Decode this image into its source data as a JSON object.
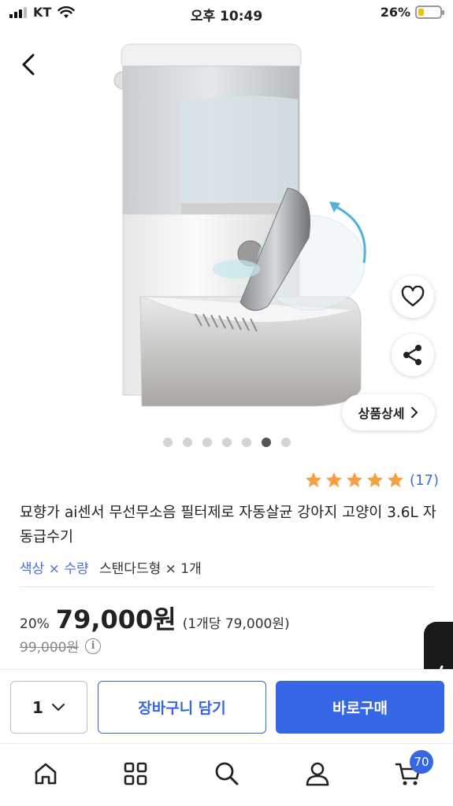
{
  "status_bar": {
    "carrier": "KT",
    "time": "오후 10:49",
    "battery_percent": "26%",
    "battery_level": 0.26
  },
  "hero": {
    "image_icon": "automatic-pet-water-dispenser-image",
    "detail_button": "상품상세",
    "slide_count": 7,
    "active_slide": 6
  },
  "product": {
    "rating": 5,
    "review_count": "(17)",
    "title": "묘향가 ai센서 무선무소음 필터제로 자동살균 강아지 고양이 3.6L 자동급수기",
    "option_label": "색상 × 수량",
    "option_value": "스탠다드형 × 1개",
    "discount": "20%",
    "price": "79,000원",
    "unit_price": "(1개당 79,000원)",
    "original_price": "99,000원"
  },
  "purchase_bar": {
    "quantity": "1",
    "cart_button": "장바구니 담기",
    "buy_button": "바로구매"
  },
  "bottom_nav": {
    "cart_count": "70"
  },
  "colors": {
    "accent": "#3466e6",
    "star": "#f5a041",
    "link": "#3b6de0"
  }
}
